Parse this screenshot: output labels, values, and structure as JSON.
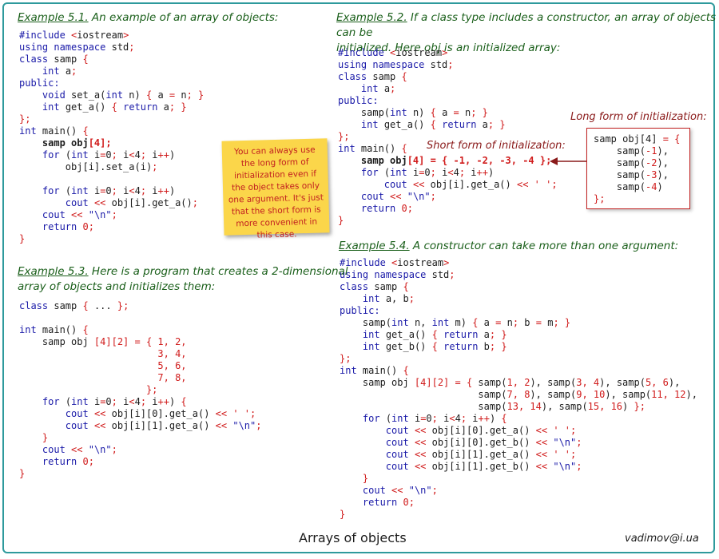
{
  "page_title": "Arrays of objects",
  "author_email": "vadimov@i.ua",
  "ex51": {
    "label": "Example 5.1.",
    "heading": " An example of an array of objects:"
  },
  "ex52": {
    "label": "Example 5.2.",
    "heading_line1": " If a class type includes a constructor, an array of objects can be",
    "heading_line2": "initialized. Here obj is an initialized array:"
  },
  "ex53": {
    "label": "Example 5.3.",
    "heading_line1": " Here is a program that creates a 2-dimensional",
    "heading_line2": "array of objects and initializes them:"
  },
  "ex54": {
    "label": "Example 5.4.",
    "heading": " A constructor can take more than one argument:"
  },
  "note": {
    "text": "You can always use the long form of initialization even if the object takes only one argument. It's just that the short form is more convenient in this case."
  },
  "annotations": {
    "long_form_label": "Long form of initialization:",
    "short_form_label": "Short form of initialization:"
  },
  "colors": {
    "border": "#2e9a9c",
    "heading": "#1a5f1a",
    "keyword": "#1a1aa8",
    "operator": "#d01a1a",
    "note_bg": "#fbd64a",
    "note_text": "#c22020",
    "annotation": "#8a1a1a"
  }
}
